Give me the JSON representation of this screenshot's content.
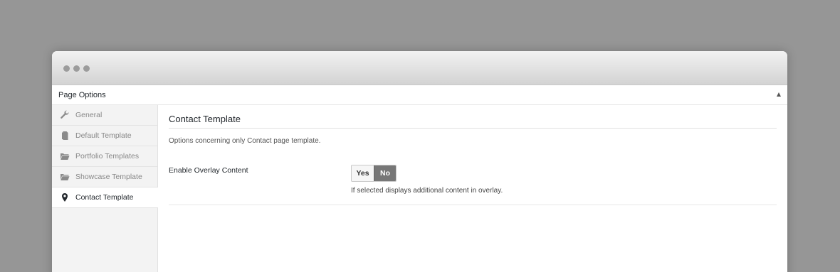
{
  "panel": {
    "title": "Page Options"
  },
  "sidebar": {
    "items": [
      {
        "label": "General",
        "icon": "wrench-icon",
        "active": false
      },
      {
        "label": "Default Template",
        "icon": "document-icon",
        "active": false
      },
      {
        "label": "Portfolio Templates",
        "icon": "folder-icon",
        "active": false
      },
      {
        "label": "Showcase Template",
        "icon": "folder-icon",
        "active": false
      },
      {
        "label": "Contact Template",
        "icon": "map-pin-icon",
        "active": true
      }
    ]
  },
  "main": {
    "title": "Contact Template",
    "description": "Options concerning only Contact page template.",
    "field": {
      "label": "Enable Overlay Content",
      "yes_label": "Yes",
      "no_label": "No",
      "selected": "No",
      "help": "If selected displays additional content in overlay."
    }
  },
  "colors": {
    "active_toggle": "#777777",
    "sidebar_bg": "#f3f3f3",
    "page_bg": "#969696"
  }
}
